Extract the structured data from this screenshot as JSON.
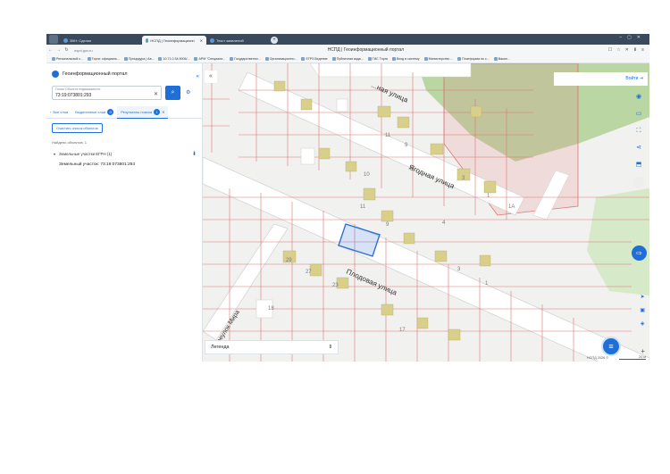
{
  "browser": {
    "tabs": [
      {
        "label": "ЗВН: Сделки"
      },
      {
        "label": "НСПД | Геоинформационн"
      },
      {
        "label": "Текст заявлений"
      }
    ],
    "new_tab": "+",
    "url": "nspd.gov.ru",
    "page_title": "НСПД | Геоинформационный портал",
    "bookmarks": [
      "Региональный к...",
      "Торги: официаль...",
      "Процедура | Ав...",
      "10.71.0.34:9006/...",
      "АРМ \"Специали...",
      "Государственно...",
      "Организационно...",
      "ЕГРЗ Ведение",
      "Публичная када...",
      "ГИС Торги",
      "Вход в систему",
      "Министерство ...",
      "Платформа по с...",
      "Вакан..."
    ]
  },
  "panel": {
    "title": "Геоинформационный портал",
    "search_label": "Поиск Объекта недвижимости",
    "search_value": "73:19:073801:293",
    "clear_icon": "✕",
    "search_icon": "⌕",
    "filter_icon": "⚙",
    "tabs": [
      {
        "label": "Все слои",
        "count": ""
      },
      {
        "label": "Выделенные слои",
        "count": "0"
      },
      {
        "label": "Результаты поиска",
        "count": "1"
      }
    ],
    "clear_button": "Очистить список объектов",
    "found_text": "Найдено объектов: 1",
    "group_label": "Земельные участки ЕГРН (1)",
    "result_item": "Земельный участок: 73:19:073801:293"
  },
  "map": {
    "login": "Войти",
    "streets": [
      "Ягодная улица",
      "Плодовая улица",
      "переулок Мира",
      "...ная улица"
    ],
    "legend_label": "Легенда",
    "copyright": "НСПД 2026 ©",
    "scale": "20 м",
    "colors": {
      "accent": "#1e6fd9",
      "parcel": "#d9534f",
      "green": "#9cc28a",
      "highlight": "#2f6fd6"
    }
  }
}
